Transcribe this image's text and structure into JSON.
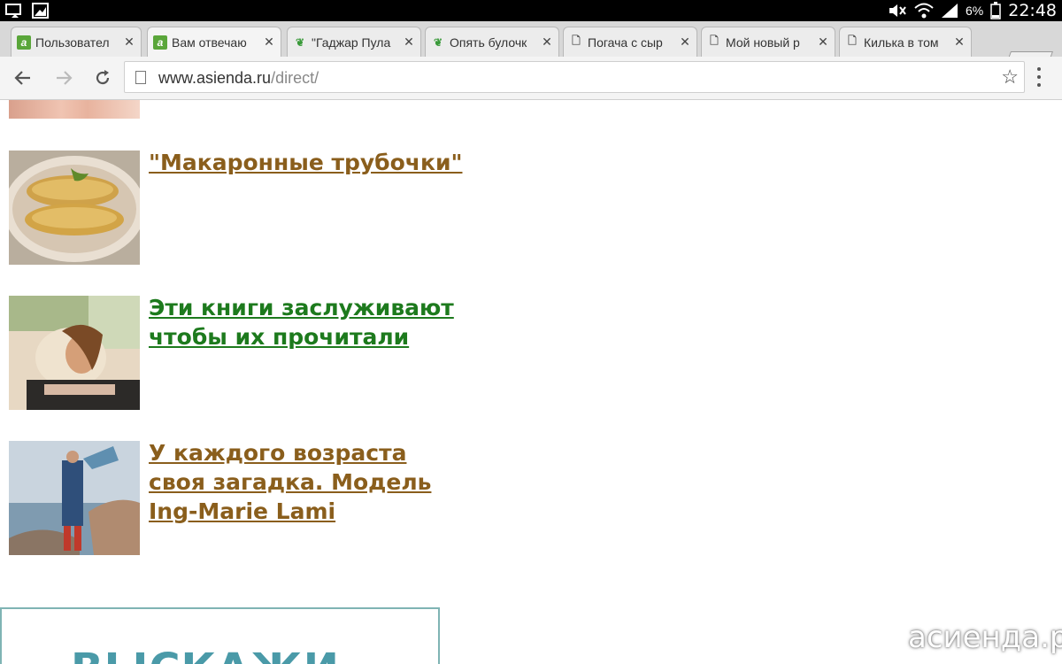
{
  "status_bar": {
    "battery": "6%",
    "time": "22:48"
  },
  "tabs": [
    {
      "title": "Пользовател",
      "favicon": "asienda-icon"
    },
    {
      "title": "Вам отвечаю",
      "favicon": "asienda-icon"
    },
    {
      "title": "\"Гаджар Пула",
      "favicon": "leaf-icon"
    },
    {
      "title": "Опять булочк",
      "favicon": "leaf-icon"
    },
    {
      "title": "Погача с сыр",
      "favicon": "page-icon"
    },
    {
      "title": "Мой новый р",
      "favicon": "page-icon"
    },
    {
      "title": "Килька в том",
      "favicon": "page-icon"
    }
  ],
  "toolbar": {
    "url_host": "www.asienda.ru",
    "url_path": "/direct/"
  },
  "articles": [
    {
      "title": "\"Макаронные трубочки\"",
      "color": "#8a5e1c"
    },
    {
      "title": "Эти книги заслуживают чтобы их прочитали",
      "color": "#1d7a1d"
    },
    {
      "title": "У каждого возраста своя загадка. Модель Ing-Marie Lami",
      "color": "#8a5e1c"
    }
  ],
  "banner": {
    "text": "ВЫСКАЖИ"
  },
  "watermark": {
    "text": "асиенда.ру"
  }
}
